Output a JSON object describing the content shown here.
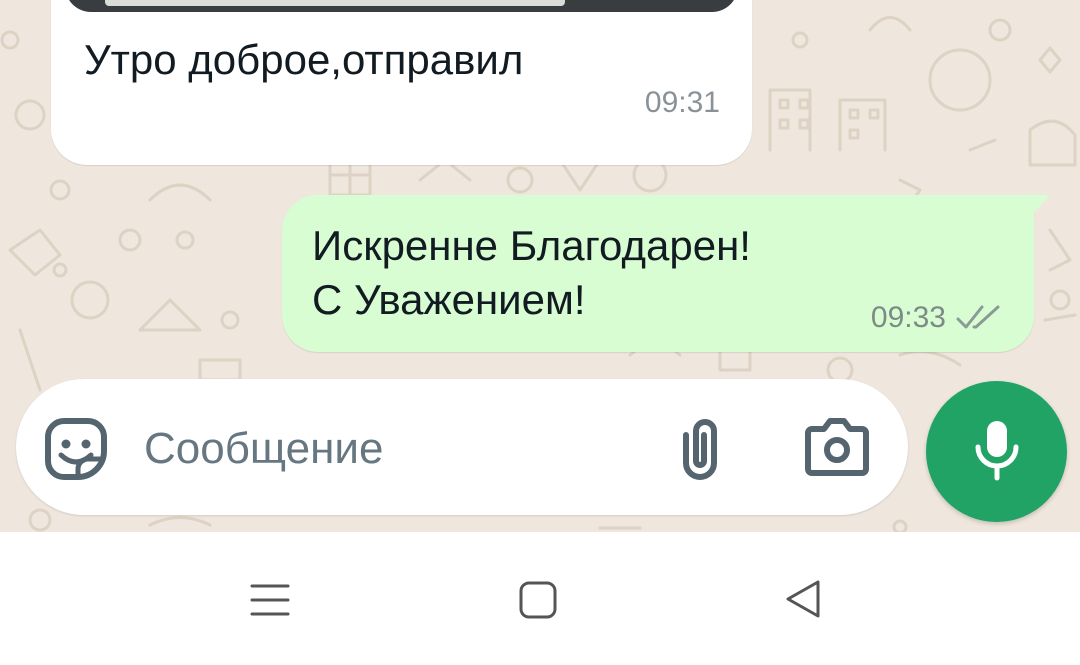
{
  "messages": [
    {
      "direction": "incoming",
      "text": "Утро доброе,отправил",
      "time": "09:31",
      "has_photo_preview": true
    },
    {
      "direction": "outgoing",
      "line1": "Искренне Благодарен!",
      "line2": "С Уважением!",
      "time": "09:33",
      "status": "delivered-double-check"
    }
  ],
  "composer": {
    "placeholder": "Сообщение",
    "value": "",
    "icons": [
      "sticker-icon",
      "paperclip-icon",
      "camera-icon",
      "microphone-icon"
    ]
  },
  "colors": {
    "wallpaper": "#efe7dd",
    "incoming_bubble": "#ffffff",
    "outgoing_bubble": "#d9fdd3",
    "mic_button": "#21a366",
    "icon_gray": "#54656f",
    "timestamp": "#8a9297"
  },
  "navigation": {
    "buttons": [
      "menu-icon",
      "home-icon",
      "back-icon"
    ]
  }
}
